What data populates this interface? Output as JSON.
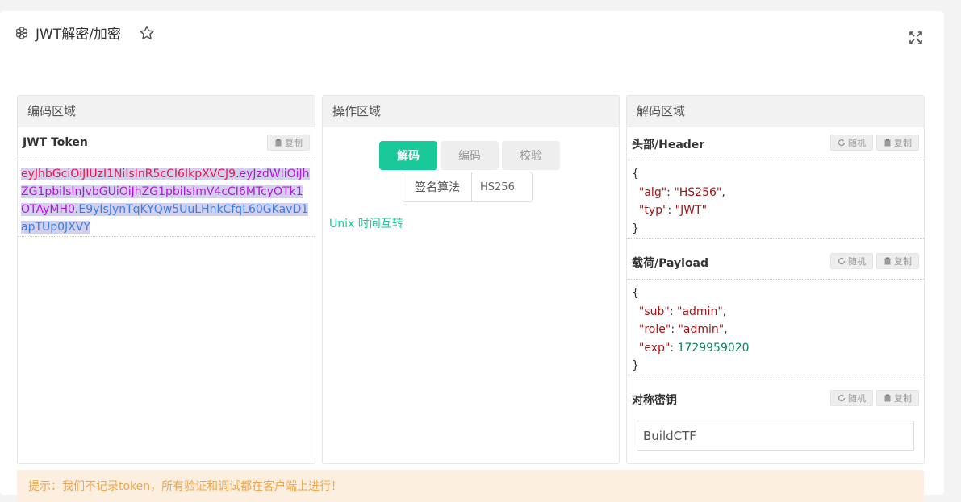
{
  "header": {
    "title": "JWT解密/加密",
    "icons": [
      "settings-gear-icon",
      "star-icon",
      "expand-icon"
    ]
  },
  "encode_panel": {
    "title": "编码区域",
    "token_label": "JWT Token",
    "copy_label": "复制",
    "token_part1": "eyJhbGciOiJIUzI1NiIsInR5cCI6IkpXVCJ9",
    "dot1": ".",
    "token_part2": "eyJzdWIiOiJhZG1pbiIsInJvbGUiOiJhZG1pbiIsImV4cCI6MTcyOTk1OTAyMH0",
    "dot2": ".",
    "token_part3": "E9yIsJynTqKYQw5UuLHhkCfqL60GKavD1apTUp0JXVY"
  },
  "operation_panel": {
    "title": "操作区域",
    "tabs": [
      {
        "label": "解码",
        "active": true
      },
      {
        "label": "编码",
        "active": false
      },
      {
        "label": "校验",
        "active": false
      }
    ],
    "algorithm_label": "签名算法",
    "algorithm_value": "HS256",
    "unix_link": "Unix 时间互转"
  },
  "decode_panel": {
    "title": "解码区域",
    "random_label": "随机",
    "copy_label": "复制",
    "header_section": {
      "title": "头部/Header",
      "alg_key": "\"alg\"",
      "alg_value": "\"HS256\"",
      "typ_key": "\"typ\"",
      "typ_value": "\"JWT\""
    },
    "payload_section": {
      "title": "载荷/Payload",
      "sub_key": "\"sub\"",
      "sub_value": "\"admin\"",
      "role_key": "\"role\"",
      "role_value": "\"admin\"",
      "exp_key": "\"exp\"",
      "exp_value": "1729959020"
    },
    "key_section": {
      "title": "对称密钥",
      "value": "BuildCTF"
    }
  },
  "tip": {
    "text": "提示：我们不记录token，所有验证和调试都在客户端上进行！"
  },
  "colors": {
    "accent": "#19c99a",
    "token_header": "#e6184e",
    "token_payload": "#b217d6",
    "token_signature": "#3d7fe0",
    "tip_bg": "#fdefe0",
    "tip_text": "#f0a64a"
  }
}
